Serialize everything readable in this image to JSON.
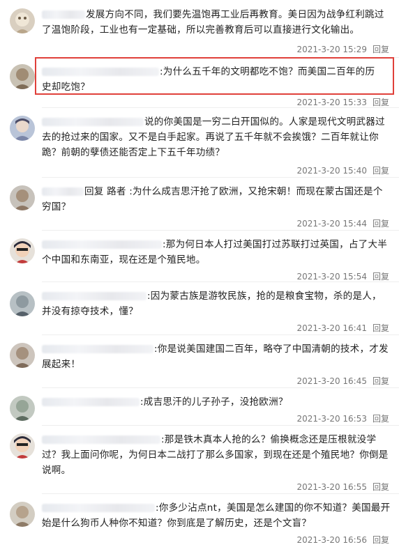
{
  "colors": {
    "highlight": "#e0403a",
    "meta": "#777777"
  },
  "comments": [
    {
      "text": "发展方向不同，我们要先温饱再工业后再教育。美日因为战争红利跳过了温饱阶段，工业也有一定基础，所以完善教育后可以直接进行文化输出。",
      "time": "2021-3-20 15:29",
      "reply": "回复"
    },
    {
      "text": ":为什么五千年的文明都吃不饱？而美国二百年的历史却吃饱？",
      "time": "2021-3-20 15:33",
      "reply": "回复"
    },
    {
      "text": "说的你美国是一穷二白开国似的。人家是现代文明武器过去的抢过来的国家。又不是白手起家。再说了五千年就不会挨饿？二百年就让你跪？前朝的孽债还能否定上下五千年功绩？",
      "time": "2021-3-20 15:40",
      "reply": "回复"
    },
    {
      "text": "回复 路者 :为什么成吉思汗抢了欧洲，又抢宋朝！而现在蒙古国还是个穷国？",
      "time": "2021-3-20 15:44",
      "reply": "回复"
    },
    {
      "text": ":那为何日本人打过美国打过苏联打过英国，占了大半个中国和东南亚，现在还是个殖民地。",
      "time": "2021-3-20 15:54",
      "reply": "回复"
    },
    {
      "text": ":因为蒙古族是游牧民族，抢的是粮食宝物，杀的是人，并没有掠夺技术，懂？",
      "time": "2021-3-20 16:41",
      "reply": "回复"
    },
    {
      "text": ":你是说美国建国二百年，略夺了中国清朝的技术，才发展起来！",
      "time": "2021-3-20 16:45",
      "reply": "回复"
    },
    {
      "text": ":成吉思汗的儿子孙子，没抢欧洲？",
      "time": "2021-3-20 16:53",
      "reply": "回复"
    },
    {
      "text": ":那是铁木真本人抢的么？偷换概念还是压根就没学过？我上面问你呢，为何日本二战打了那么多国家，到现在还是个殖民地？你倒是说啊。",
      "time": "2021-3-20 16:55",
      "reply": "回复"
    },
    {
      "text": ":你多少沾点nt，美国是怎么建国的你不知道？美国最开始是什么狗币人种你不知道？你到底是了解历史，还是个文盲？",
      "time": "2021-3-20 16:56",
      "reply": "回复"
    }
  ]
}
